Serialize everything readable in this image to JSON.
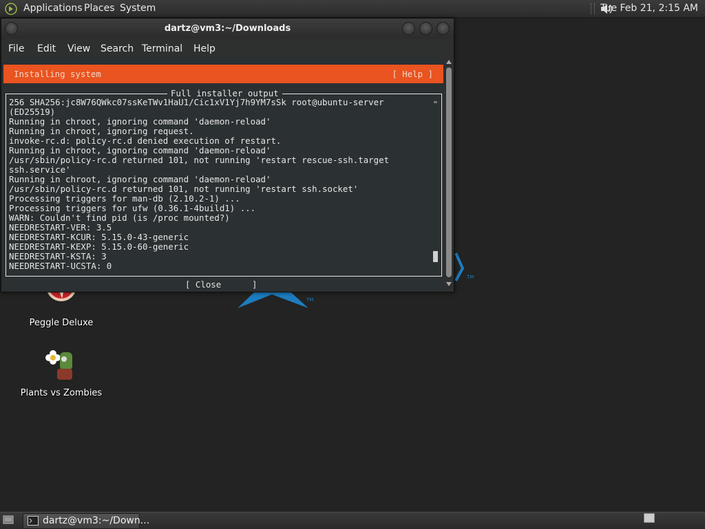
{
  "top_panel": {
    "menus": [
      "Applications",
      "Places",
      "System"
    ],
    "clock": "Tue Feb 21,  2:15 AM"
  },
  "desktop": {
    "icons": [
      {
        "label": "Peggle Deluxe"
      },
      {
        "label": "Plants vs Zombies"
      }
    ],
    "logo_color": "#1d7cbf"
  },
  "window": {
    "title": "dartz@vm3:~/Downloads",
    "menu": [
      "File",
      "Edit",
      "View",
      "Search",
      "Terminal",
      "Help"
    ],
    "installer": {
      "header": "Installing system",
      "help": "[ Help ]",
      "output_title": "Full installer output",
      "lines": [
        "256 SHA256:jc8W76QWkc07ssKeTWv1HaU1/Cic1xV1Yj7h9YM7sSk root@ubuntu-server",
        "(ED25519)",
        "Running in chroot, ignoring command 'daemon-reload'",
        "Running in chroot, ignoring request.",
        "invoke-rc.d: policy-rc.d denied execution of restart.",
        "Running in chroot, ignoring command 'daemon-reload'",
        "/usr/sbin/policy-rc.d returned 101, not running 'restart rescue-ssh.target",
        "ssh.service'",
        "Running in chroot, ignoring command 'daemon-reload'",
        "/usr/sbin/policy-rc.d returned 101, not running 'restart ssh.socket'",
        "Processing triggers for man-db (2.10.2-1) ...",
        "Processing triggers for ufw (0.36.1-4build1) ...",
        "WARN: Couldn't find pid (is /proc mounted?)",
        "NEEDRESTART-VER: 3.5",
        "NEEDRESTART-KCUR: 5.15.0-43-generic",
        "NEEDRESTART-KEXP: 5.15.0-60-generic",
        "NEEDRESTART-KSTA: 3",
        "NEEDRESTART-UCSTA: 0"
      ],
      "close_label": "[ Close      ]",
      "accent": "#e95420"
    }
  },
  "taskbar": {
    "task_label": "dartz@vm3:~/Down..."
  }
}
